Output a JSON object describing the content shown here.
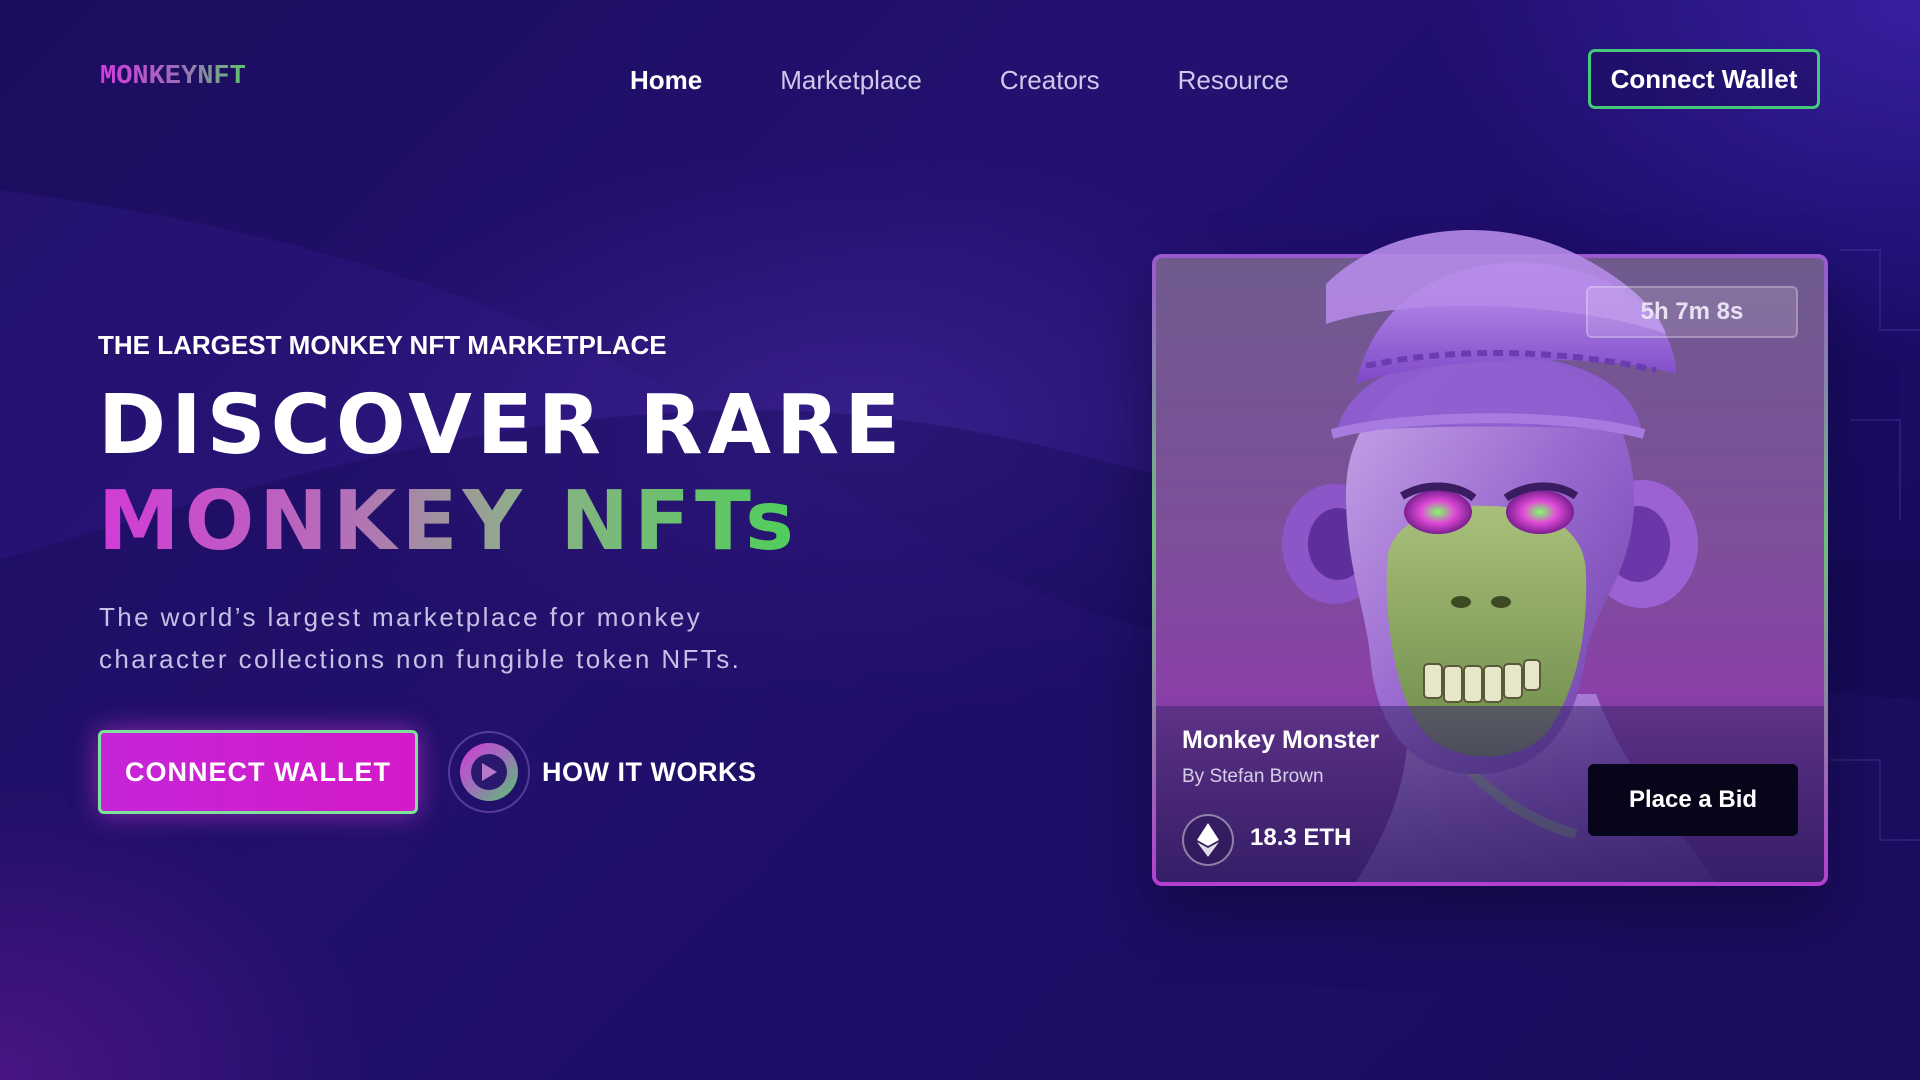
{
  "brand": {
    "logo_text": "MONKEYNFT"
  },
  "nav": {
    "links": [
      {
        "label": "Home",
        "active": true
      },
      {
        "label": "Marketplace",
        "active": false
      },
      {
        "label": "Creators",
        "active": false
      },
      {
        "label": "Resource",
        "active": false
      }
    ],
    "wallet_button": "Connect Wallet"
  },
  "hero": {
    "eyebrow": "THE LARGEST MONKEY NFT MARKETPLACE",
    "headline_line1": "DISCOVER RARE",
    "headline_line2": "MONKEY NFTs",
    "description": "The world’s largest marketplace for monkey character collections non fungible token NFTs.",
    "primary_cta": "CONNECT WALLET",
    "secondary_cta": "HOW IT WORKS"
  },
  "nft_card": {
    "countdown": "5h 7m 8s",
    "name": "Monkey Monster",
    "creator": "By Stefan Brown",
    "price": "18.3 ETH",
    "bid_button": "Place a Bid",
    "currency_icon": "ethereum-icon"
  },
  "colors": {
    "background": "#1b0d5e",
    "accent_magenta": "#d31ac9",
    "accent_green": "#43c979"
  }
}
